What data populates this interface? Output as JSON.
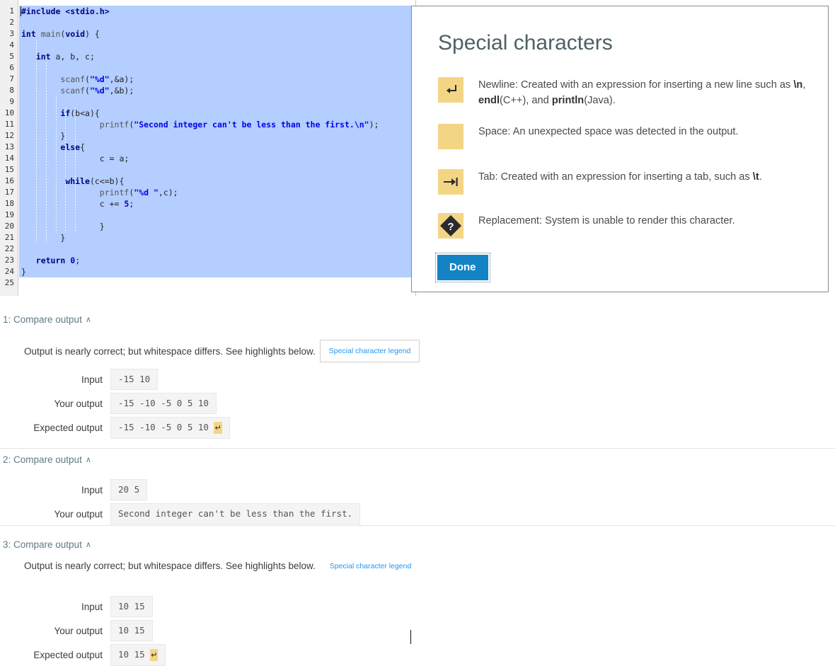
{
  "editor": {
    "language": "c",
    "total_lines": 25,
    "selection": {
      "from_line": 1,
      "to_line": 24
    },
    "lines": [
      {
        "n": 1,
        "text": "#include <stdio.h>"
      },
      {
        "n": 2,
        "text": ""
      },
      {
        "n": 3,
        "text": "int main(void) {"
      },
      {
        "n": 4,
        "text": ""
      },
      {
        "n": 5,
        "text": "   int a, b, c;"
      },
      {
        "n": 6,
        "text": ""
      },
      {
        "n": 7,
        "text": "        scanf(\"%d\",&a);"
      },
      {
        "n": 8,
        "text": "        scanf(\"%d\",&b);"
      },
      {
        "n": 9,
        "text": ""
      },
      {
        "n": 10,
        "text": "        if(b<a){"
      },
      {
        "n": 11,
        "text": "                printf(\"Second integer can't be less than the first.\\n\");"
      },
      {
        "n": 12,
        "text": "        }"
      },
      {
        "n": 13,
        "text": "        else{"
      },
      {
        "n": 14,
        "text": "                c = a;"
      },
      {
        "n": 15,
        "text": ""
      },
      {
        "n": 16,
        "text": "         while(c<=b){"
      },
      {
        "n": 17,
        "text": "                printf(\"%d \",c);"
      },
      {
        "n": 18,
        "text": "                c += 5;"
      },
      {
        "n": 19,
        "text": ""
      },
      {
        "n": 20,
        "text": "                }"
      },
      {
        "n": 21,
        "text": "        }"
      },
      {
        "n": 22,
        "text": ""
      },
      {
        "n": 23,
        "text": "   return 0;"
      },
      {
        "n": 24,
        "text": "}"
      },
      {
        "n": 25,
        "text": ""
      }
    ]
  },
  "dialog": {
    "title": "Special characters",
    "done_label": "Done",
    "entries": [
      {
        "icon": "newline-icon",
        "glyph": "↵",
        "label": "Newline",
        "text_parts": [
          {
            "t": "Newline: Created with an expression for inserting a new line such as ",
            "b": false
          },
          {
            "t": "\\n",
            "b": true
          },
          {
            "t": ", ",
            "b": false
          },
          {
            "t": "endl",
            "b": true
          },
          {
            "t": "(C++), and ",
            "b": false
          },
          {
            "t": "println",
            "b": true
          },
          {
            "t": "(Java).",
            "b": false
          }
        ]
      },
      {
        "icon": "space-icon",
        "glyph": "",
        "label": "Space",
        "text_parts": [
          {
            "t": "Space: An unexpected space was detected in the output.",
            "b": false
          }
        ]
      },
      {
        "icon": "tab-icon",
        "glyph": "→|",
        "label": "Tab",
        "text_parts": [
          {
            "t": "Tab: Created with an expression for inserting a tab, such as ",
            "b": false
          },
          {
            "t": "\\t",
            "b": true
          },
          {
            "t": ".",
            "b": false
          }
        ]
      },
      {
        "icon": "replacement-icon",
        "glyph": "?",
        "label": "Replacement",
        "text_parts": [
          {
            "t": "Replacement: System is unable to render this character.",
            "b": false
          }
        ]
      }
    ]
  },
  "colors": {
    "accent_blue": "#1383c6",
    "link_blue": "#2196f3",
    "highlight_yellow": "#f3d586",
    "selection_blue": "#b3ceff",
    "header_slate": "#5f7a87"
  },
  "compare": {
    "labels": {
      "input": "Input",
      "your_output": "Your output",
      "expected_output": "Expected output"
    },
    "notice": "Output is nearly correct; but whitespace differs. See highlights below.",
    "legend_label": "Special character legend",
    "sections": [
      {
        "header": "1: Compare output",
        "chevron": "∧",
        "has_notice": true,
        "legend_style": "button",
        "rows": [
          {
            "label": "Input",
            "value": "-15 10",
            "newline_mark": false
          },
          {
            "label": "Your output",
            "value": "-15 -10 -5 0 5 10",
            "newline_mark": false
          },
          {
            "label": "Expected output",
            "value": "-15 -10 -5 0 5 10 ",
            "newline_mark": true
          }
        ]
      },
      {
        "header": "2: Compare output",
        "chevron": "∧",
        "has_notice": false,
        "legend_style": "none",
        "rows": [
          {
            "label": "Input",
            "value": "20 5",
            "newline_mark": false
          },
          {
            "label": "Your output",
            "value": "Second integer can't be less than the first.",
            "newline_mark": false
          }
        ]
      },
      {
        "header": "3: Compare output",
        "chevron": "∧",
        "has_notice": true,
        "legend_style": "link",
        "rows": [
          {
            "label": "Input",
            "value": "10 15",
            "newline_mark": false
          },
          {
            "label": "Your output",
            "value": "10 15",
            "newline_mark": false
          },
          {
            "label": "Expected output",
            "value": "10 15 ",
            "newline_mark": true
          }
        ]
      }
    ]
  }
}
